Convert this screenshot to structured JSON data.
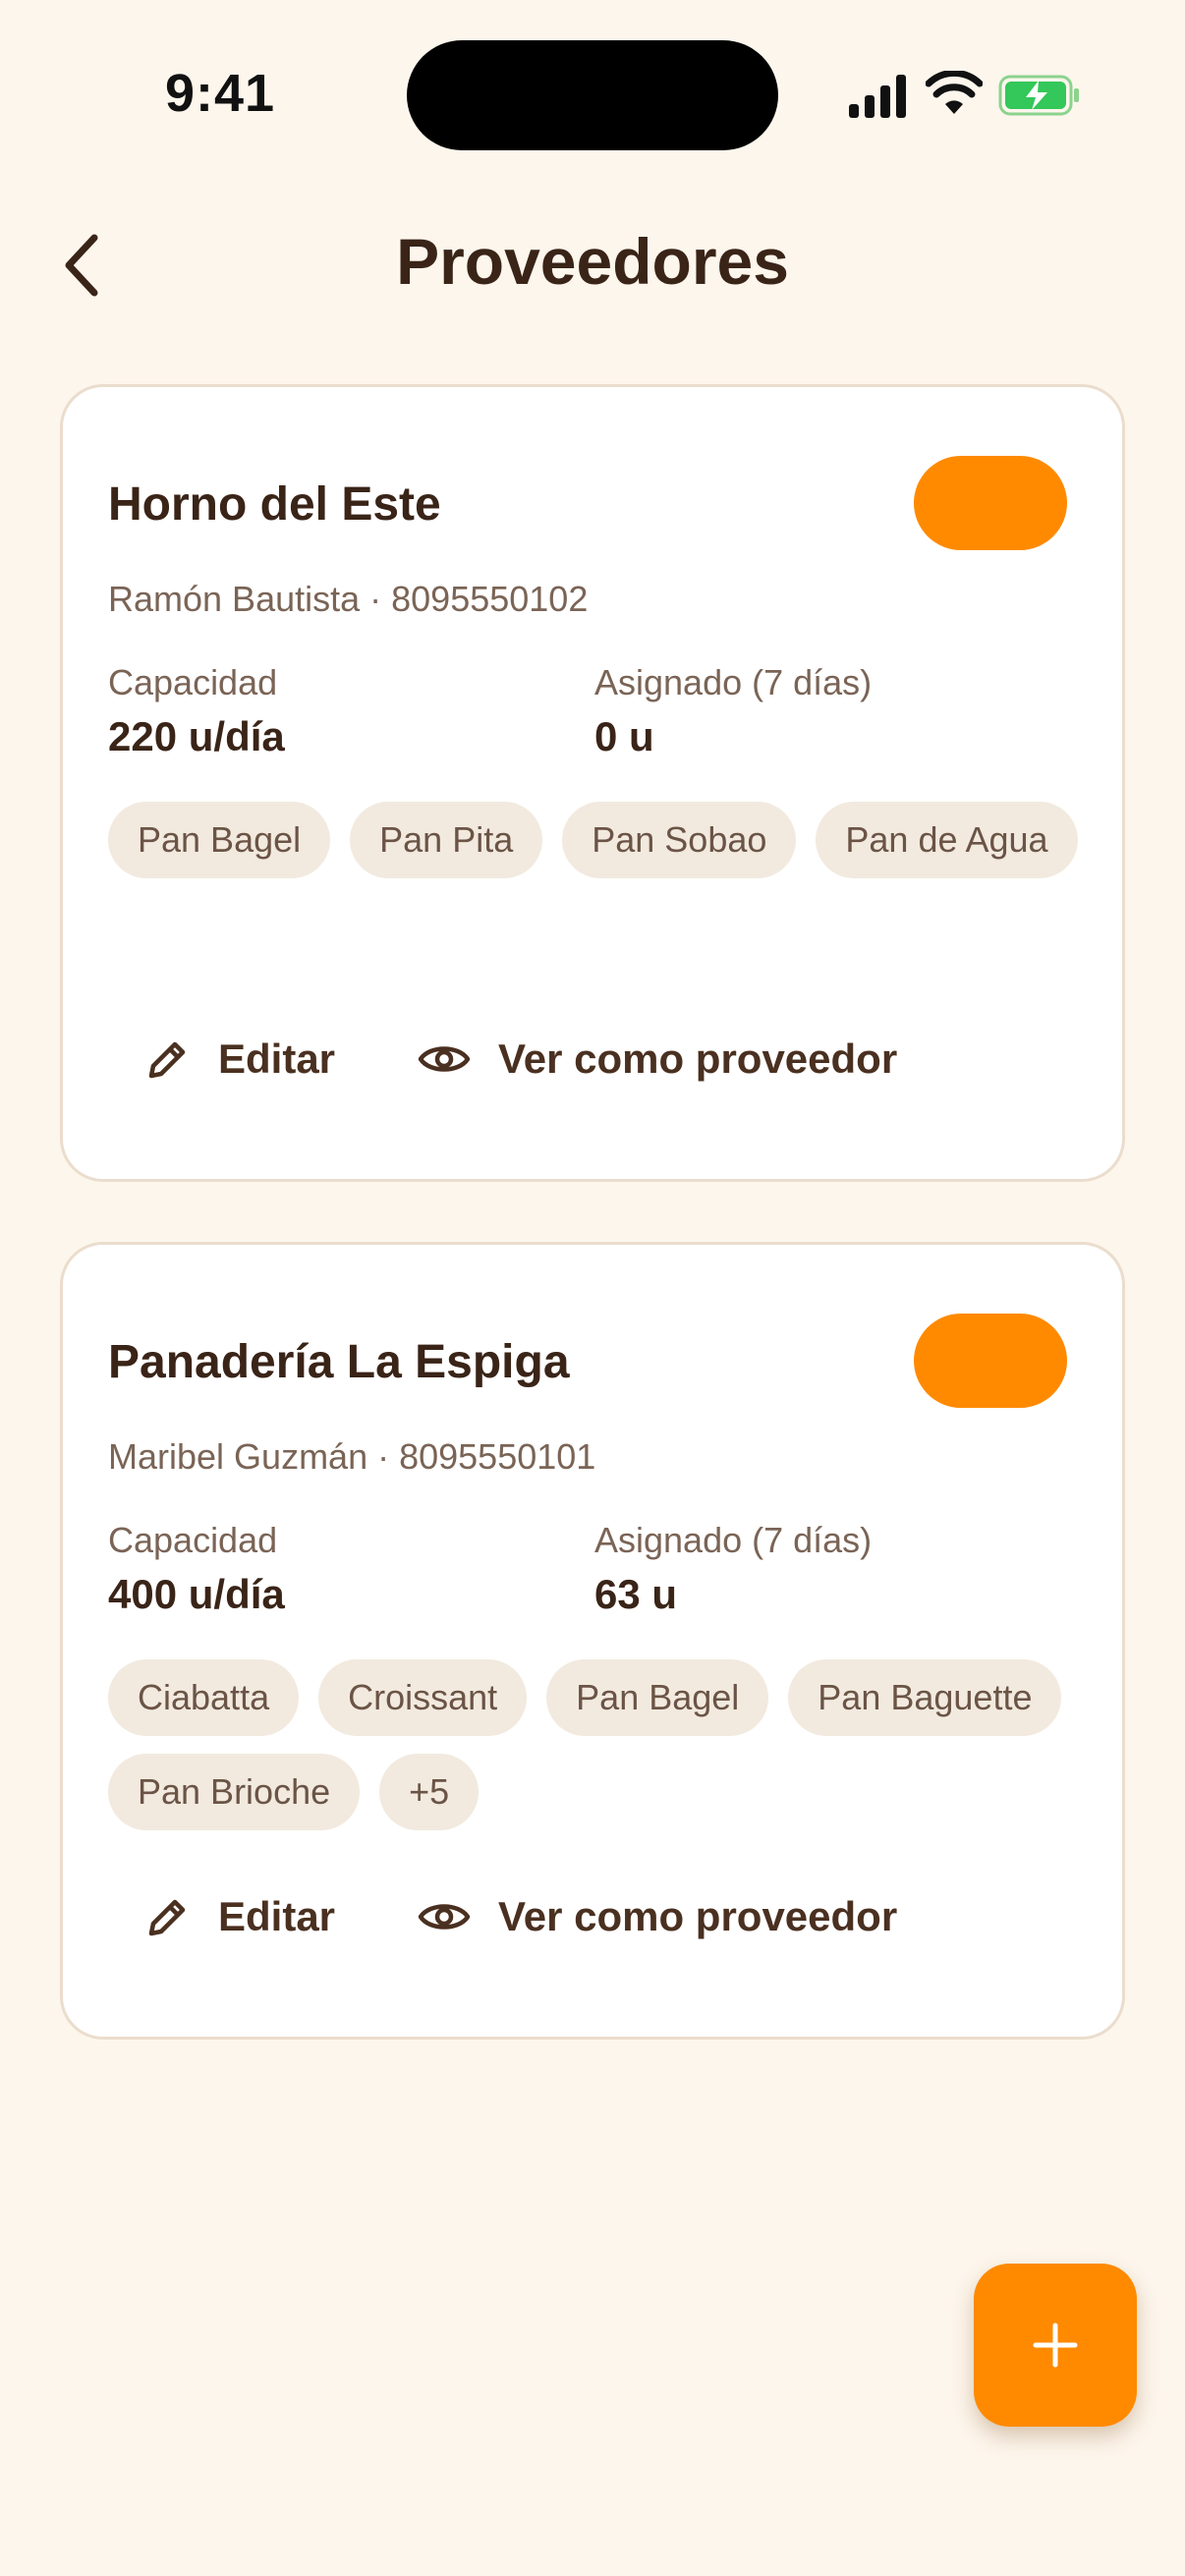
{
  "status_bar": {
    "time": "9:41"
  },
  "header": {
    "title": "Proveedores"
  },
  "colors": {
    "accent": "#FF8A00",
    "background": "#FDF6EC",
    "chip": "#F2EADF",
    "text": "#3A2418"
  },
  "providers": [
    {
      "name": "Horno del Este",
      "contact": "Ramón Bautista · 8095550102",
      "capacity_label": "Capacidad",
      "capacity_value": "220 u/día",
      "assigned_label": "Asignado (7 días)",
      "assigned_value": "0 u",
      "products": [
        "Pan Bagel",
        "Pan Pita",
        "Pan Sobao",
        "Pan de Agua"
      ],
      "edit_label": "Editar",
      "view_label": "Ver como proveedor"
    },
    {
      "name": "Panadería La Espiga",
      "contact": "Maribel Guzmán · 8095550101",
      "capacity_label": "Capacidad",
      "capacity_value": "400 u/día",
      "assigned_label": "Asignado (7 días)",
      "assigned_value": "63 u",
      "products": [
        "Ciabatta",
        "Croissant",
        "Pan Bagel",
        "Pan Baguette",
        "Pan Brioche",
        "+5"
      ],
      "edit_label": "Editar",
      "view_label": "Ver como proveedor"
    }
  ],
  "icons": {
    "back": "chevron-left-icon",
    "edit": "pencil-icon",
    "view": "eye-icon",
    "add": "plus-icon"
  }
}
